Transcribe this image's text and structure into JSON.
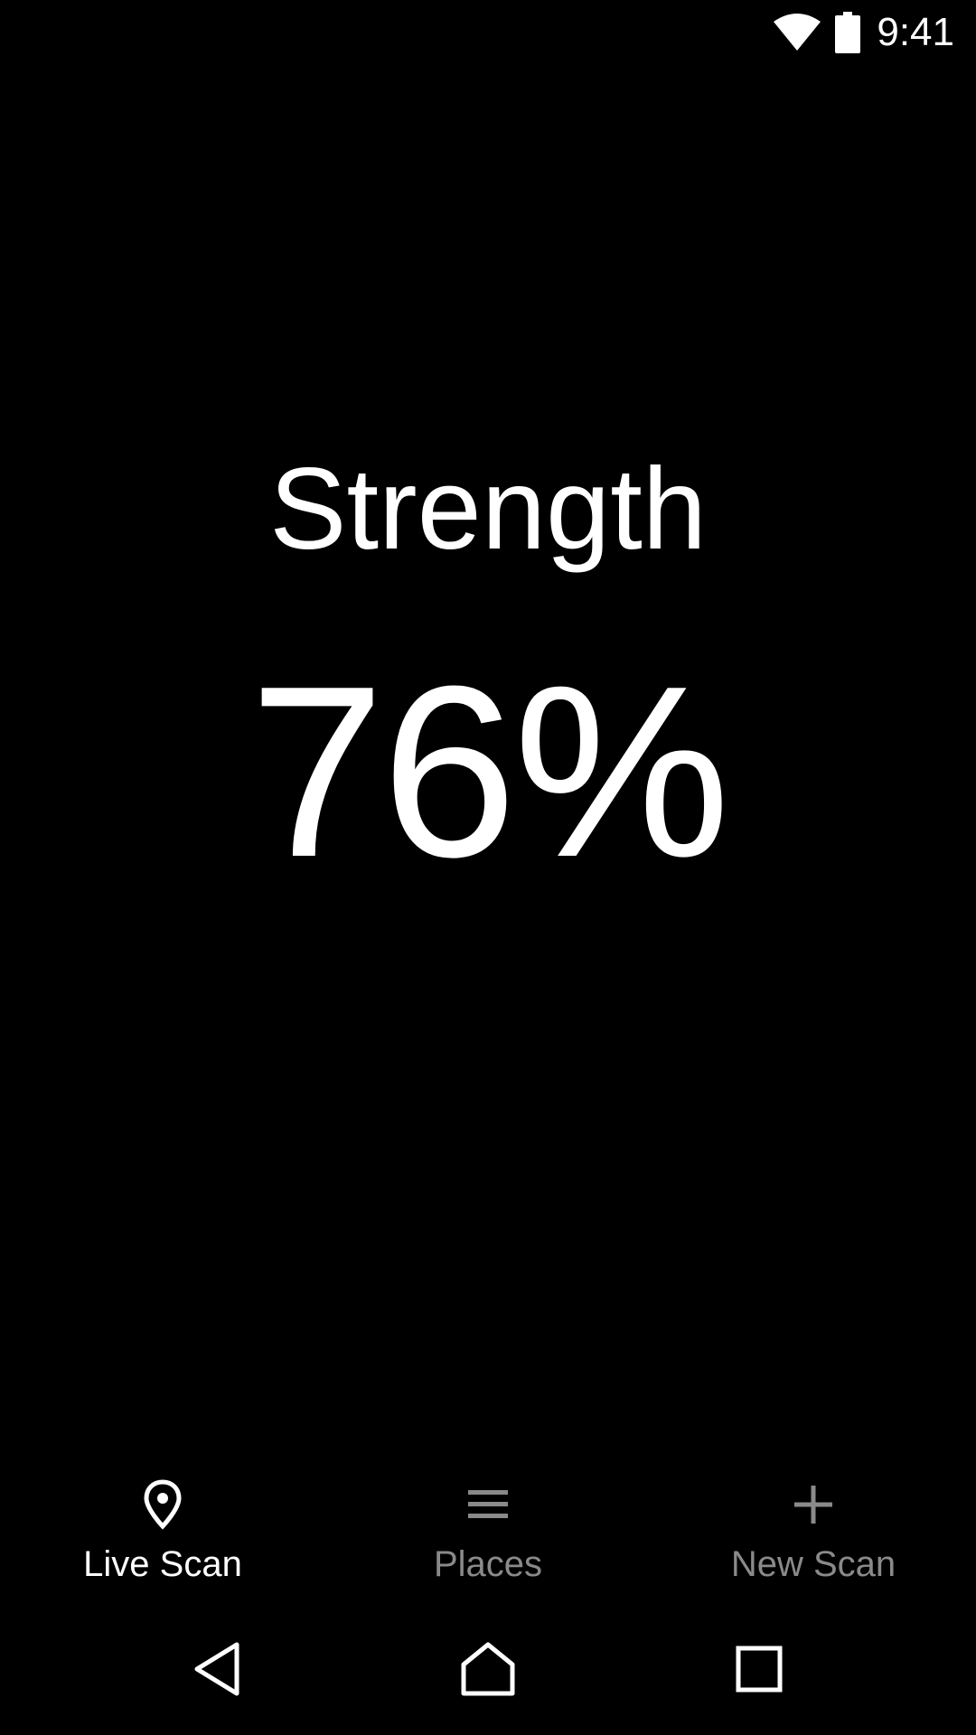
{
  "status_bar": {
    "time": "9:41",
    "wifi_icon": "wifi-icon",
    "battery_icon": "battery-icon"
  },
  "main": {
    "label": "Strength",
    "value": "76%"
  },
  "bottom_nav": {
    "items": [
      {
        "label": "Live Scan",
        "icon": "location-pin-icon",
        "active": true
      },
      {
        "label": "Places",
        "icon": "menu-list-icon",
        "active": false
      },
      {
        "label": "New Scan",
        "icon": "plus-icon",
        "active": false
      }
    ]
  },
  "system_nav": {
    "back_icon": "back-triangle-icon",
    "home_icon": "home-icon",
    "recents_icon": "recents-square-icon"
  },
  "colors": {
    "background": "#000000",
    "active": "#ffffff",
    "inactive": "#8a8a8a"
  }
}
